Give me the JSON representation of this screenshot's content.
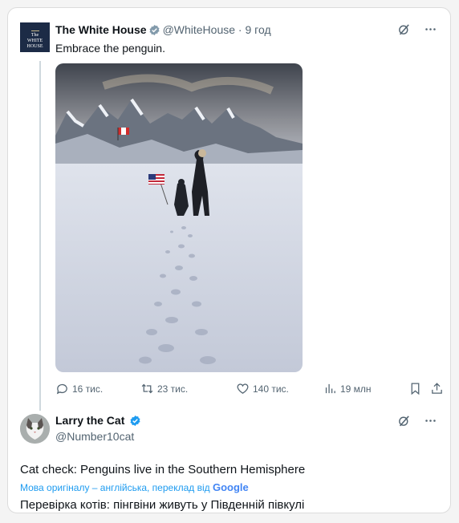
{
  "tweet": {
    "author_name": "The White House",
    "handle": "@WhiteHouse",
    "dot": "·",
    "time": "9 год",
    "avatar_text_line1": "The",
    "avatar_text_line2": "WHITE",
    "avatar_text_line3": "HOUSE",
    "text": "Embrace the penguin.",
    "actions": {
      "replies": "16 тис.",
      "reposts": "23 тис.",
      "likes": "140 тис.",
      "views": "19 млн"
    },
    "verified_color": "#829aab"
  },
  "reply": {
    "author_name": "Larry the Cat",
    "handle": "@Number10cat",
    "text": "Cat check: Penguins live in the Southern Hemisphere",
    "translation_note": "Мова оригіналу – англійська, переклад від",
    "translation_brand": "Google",
    "translated_text": "Перевірка котів: пінгвіни живуть у Південній півкулі",
    "verified_color": "#1d9bf0"
  },
  "colors": {
    "secondary_text": "#536471",
    "link": "#1d9bf0"
  }
}
